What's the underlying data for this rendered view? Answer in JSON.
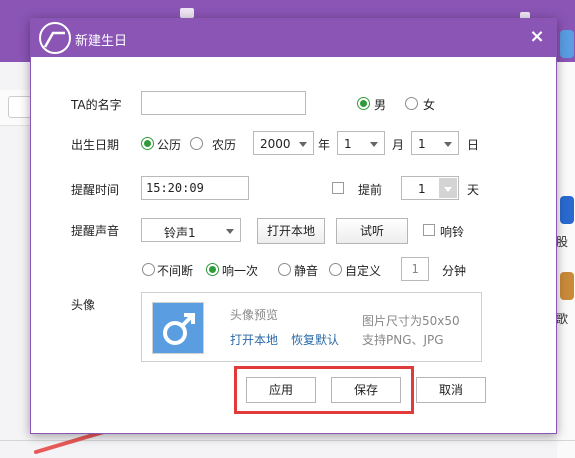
{
  "background": {
    "right_labels": [
      "股",
      "歌"
    ]
  },
  "dialog": {
    "title": "新建生日",
    "close_label": "×",
    "name_label": "TA的名字",
    "name_value": "",
    "gender_male": "男",
    "gender_female": "女",
    "gender_selected": "male",
    "birth_label": "出生日期",
    "calendar_solar": "公历",
    "calendar_lunar": "农历",
    "year_value": "2000",
    "year_unit": "年",
    "month_value": "1",
    "month_unit": "月",
    "day_value": "1",
    "day_unit": "日",
    "remind_time_label": "提醒时间",
    "remind_time_value": "15:20:09",
    "advance_label": "提前",
    "advance_value": "1",
    "advance_unit": "天",
    "sound_label": "提醒声音",
    "sound_value": "铃声1",
    "open_local_button": "打开本地",
    "listen_button": "试听",
    "ring_label": "响铃",
    "repeat_options": [
      "不间断",
      "响一次",
      "静音",
      "自定义"
    ],
    "repeat_selected": 1,
    "custom_minutes_value": "1",
    "minutes_unit": "分钟",
    "avatar_label": "头像",
    "avatar_preview": "头像预览",
    "avatar_size_hint": "图片尺寸为50x50",
    "avatar_open_local": "打开本地",
    "avatar_restore_default": "恢复默认",
    "avatar_format_hint": "支持PNG、JPG",
    "apply_button": "应用",
    "save_button": "保存",
    "cancel_button": "取消"
  },
  "colors": {
    "brand_purple": "#8a55b5",
    "radio_green": "#2f9a3a",
    "highlight_red": "#e03a3a",
    "avatar_blue": "#5a9de0"
  }
}
